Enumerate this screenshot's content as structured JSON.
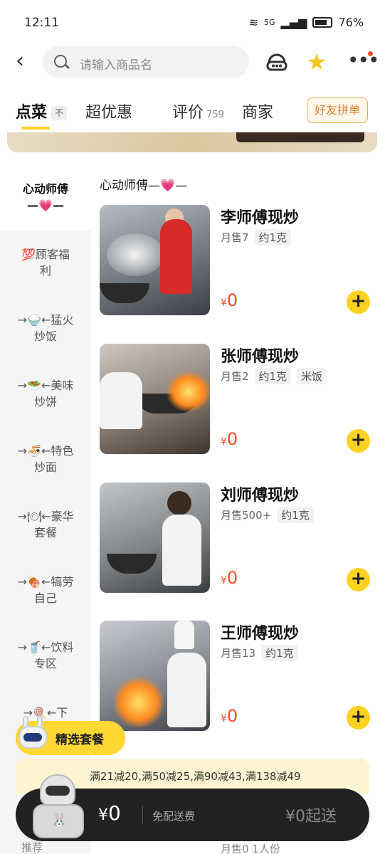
{
  "status_bar": {
    "time": "12:11",
    "network": "5G",
    "battery": "76%"
  },
  "header": {
    "search_placeholder": "请输入商品名",
    "icons": [
      "back-icon",
      "search-icon",
      "customer-service-icon",
      "star-icon",
      "more-icon"
    ]
  },
  "tabs": {
    "order": "点菜",
    "order_pin": "不",
    "deals": "超优惠",
    "reviews": "评价",
    "reviews_count": "759",
    "merchant": "商家",
    "group_order": "好友拼单"
  },
  "sidebar": {
    "items": [
      {
        "label": "心动师傅—💗—"
      },
      {
        "label": "💯顾客福利"
      },
      {
        "label": "→🍚←猛火炒饭"
      },
      {
        "label": "→🥗←美味炒饼"
      },
      {
        "label": "→🍜←特色炒面"
      },
      {
        "label": "→🍽←豪华套餐"
      },
      {
        "label": "→🍖←犒劳自己"
      },
      {
        "label": "→🥤←饮料专区"
      },
      {
        "label": "→🍭←下"
      }
    ],
    "peek": "推荐"
  },
  "section_title": "心动师傅—💗—",
  "dishes": [
    {
      "name": "李师傅现炒",
      "sales": "月售7",
      "tags": [
        "约1克"
      ],
      "price_symbol": "¥",
      "price": "0"
    },
    {
      "name": "张师傅现炒",
      "sales": "月售2",
      "tags": [
        "约1克",
        "米饭"
      ],
      "price_symbol": "¥",
      "price": "0"
    },
    {
      "name": "刘师傅现炒",
      "sales": "月售500+",
      "tags": [
        "约1克"
      ],
      "price_symbol": "¥",
      "price": "0"
    },
    {
      "name": "王师傅现炒",
      "sales": "月售13",
      "tags": [
        "约1克"
      ],
      "price_symbol": "¥",
      "price": "0"
    }
  ],
  "next_dish_peek": "月售0  1人份",
  "combo_banner": "精选套餐",
  "promo": "满21减20,满50减25,满90减43,满138减49",
  "cart": {
    "currency": "¥",
    "total": "0",
    "delivery": "免配送费",
    "minimum": "¥0起送"
  },
  "colors": {
    "accent": "#ffd21f",
    "price": "#ff4a26",
    "cart_bg": "#222222",
    "group_btn": "#e8802a"
  }
}
